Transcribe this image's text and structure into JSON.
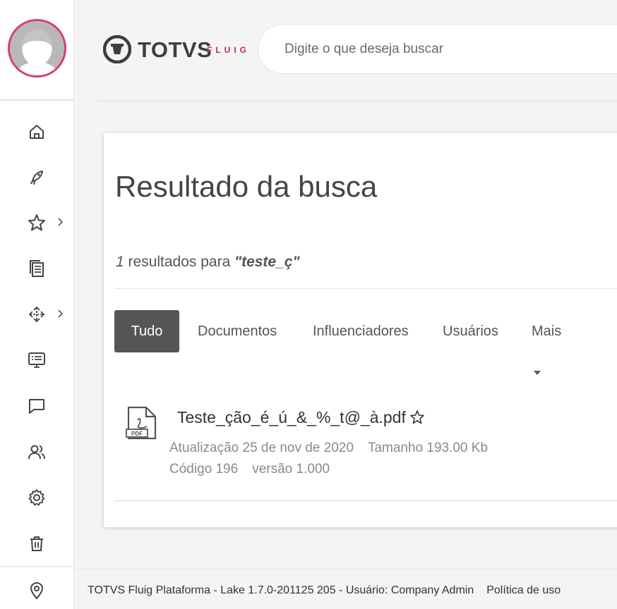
{
  "brand": {
    "name": "TOTVS",
    "sub": "FLUIG"
  },
  "search": {
    "placeholder": "Digite o que deseja buscar",
    "value": ""
  },
  "sidebar": {
    "items": [
      {
        "name": "home",
        "icon": "home-icon",
        "has_submenu": false
      },
      {
        "name": "launch",
        "icon": "rocket-icon",
        "has_submenu": false
      },
      {
        "name": "favorites",
        "icon": "star-icon",
        "has_submenu": true
      },
      {
        "name": "documents",
        "icon": "documents-icon",
        "has_submenu": false
      },
      {
        "name": "processes",
        "icon": "process-arrows-icon",
        "has_submenu": true
      },
      {
        "name": "tasks",
        "icon": "monitor-list-icon",
        "has_submenu": false
      },
      {
        "name": "messages",
        "icon": "chat-icon",
        "has_submenu": false
      },
      {
        "name": "users",
        "icon": "users-icon",
        "has_submenu": false
      },
      {
        "name": "settings",
        "icon": "gear-icon",
        "has_submenu": false
      },
      {
        "name": "trash",
        "icon": "trash-icon",
        "has_submenu": false
      },
      {
        "name": "location",
        "icon": "location-pin-icon",
        "has_submenu": false
      }
    ]
  },
  "main": {
    "title": "Resultado da busca",
    "result_count": "1",
    "result_text": " resultados para ",
    "query": "\"teste_ç\"",
    "tabs": [
      {
        "label": "Tudo",
        "active": true
      },
      {
        "label": "Documentos",
        "active": false
      },
      {
        "label": "Influenciadores",
        "active": false
      },
      {
        "label": "Usuários",
        "active": false
      },
      {
        "label": "Mais",
        "active": false
      }
    ],
    "results": [
      {
        "title": "Teste_ção_é_ú_&_%_t@_à.pdf",
        "file_type_icon": "pdf-icon",
        "updated": "Atualização 25 de nov de 2020",
        "size": "Tamanho 193.00 Kb",
        "code": "Código 196",
        "version": "versão 1.000"
      }
    ]
  },
  "footer": {
    "text": "TOTVS Fluig Plataforma - Lake 1.7.0-201125 205 - Usuário: Company Admin",
    "policy_link": "Política de uso"
  },
  "colors": {
    "accent": "#d8406a",
    "tab_active_bg": "#555555",
    "background": "#f4f4f4"
  }
}
